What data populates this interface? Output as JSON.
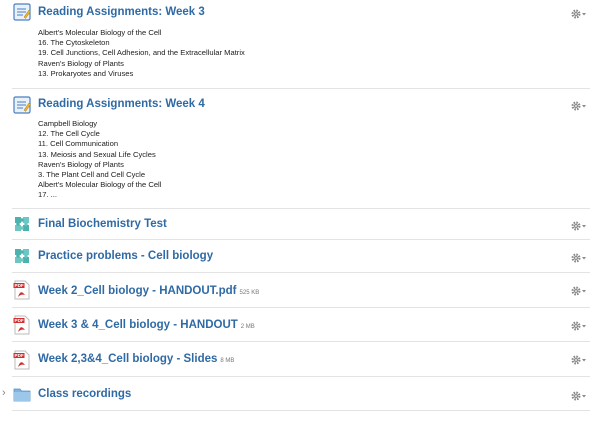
{
  "activities": [
    {
      "type": "assignment",
      "title": "Reading Assignments: Week 3",
      "lines": [
        "Albert's Molecular Biology of the Cell",
        "16. The Cytoskeleton",
        "19. Cell Junctions, Cell Adhesion, and the Extracellular Matrix",
        "Raven's Biology of Plants",
        "13. Prokaryotes and Viruses"
      ]
    },
    {
      "type": "assignment",
      "title": "Reading Assignments: Week 4",
      "lines": [
        "Campbell Biology",
        "12. The Cell Cycle",
        "11. Cell Communication",
        "13. Meiosis and Sexual Life Cycles",
        "Raven's Biology of Plants",
        "3. The Plant Cell and Cell Cycle",
        "Albert's Molecular Biology of the Cell",
        "17. ..."
      ]
    },
    {
      "type": "quiz",
      "title": "Final Biochemistry Test"
    },
    {
      "type": "quiz",
      "title": "Practice problems - Cell biology"
    },
    {
      "type": "pdf",
      "title": "Week 2_Cell biology - HANDOUT.pdf",
      "size": "525 KB"
    },
    {
      "type": "pdf",
      "title": "Week 3 & 4_Cell biology - HANDOUT",
      "size": "2 MB"
    },
    {
      "type": "pdf",
      "title": "Week 2,3&4_Cell biology - Slides",
      "size": "8 MB"
    },
    {
      "type": "folder",
      "title": "Class recordings"
    }
  ],
  "icons": {
    "assignment": "assignment-icon",
    "quiz": "quiz-puzzle-icon",
    "pdf": "pdf-icon",
    "folder": "folder-icon",
    "gear": "gear-dropdown-icon",
    "expand": "chevron-right-icon"
  },
  "colors": {
    "link": "#2f6aa5",
    "quiz": "#4cb2ae",
    "pdf": "#d32f2f",
    "folder": "#7fb3df"
  }
}
